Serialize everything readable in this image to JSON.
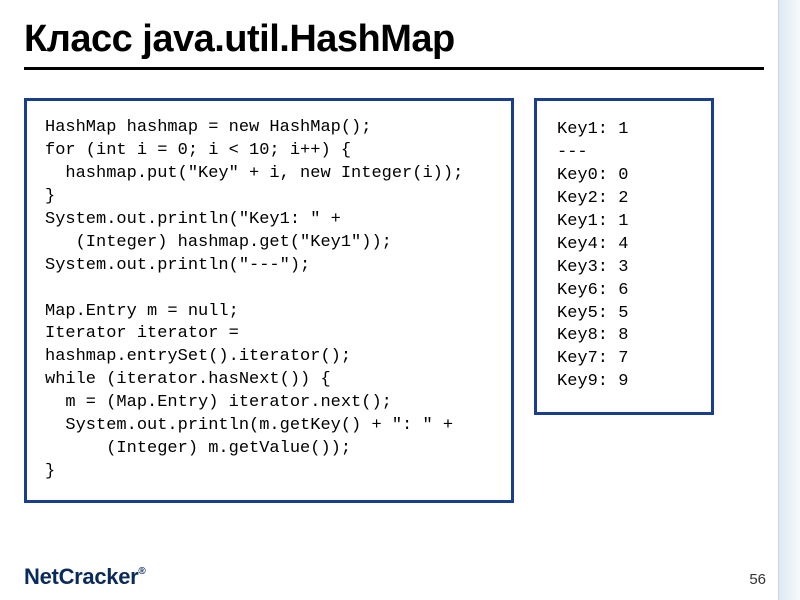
{
  "title": "Класс java.util.HashMap",
  "code_main": "HashMap hashmap = new HashMap();\nfor (int i = 0; i < 10; i++) {\n  hashmap.put(\"Key\" + i, new Integer(i));\n}\nSystem.out.println(\"Key1: \" +\n   (Integer) hashmap.get(\"Key1\"));\nSystem.out.println(\"---\");\n\nMap.Entry m = null;\nIterator iterator =\nhashmap.entrySet().iterator();\nwhile (iterator.hasNext()) {\n  m = (Map.Entry) iterator.next();\n  System.out.println(m.getKey() + \": \" +\n      (Integer) m.getValue());\n}",
  "code_output": "Key1: 1\n---\nKey0: 0\nKey2: 2\nKey1: 1\nKey4: 4\nKey3: 3\nKey6: 6\nKey5: 5\nKey8: 8\nKey7: 7\nKey9: 9",
  "footer": {
    "logo_net": "Net",
    "logo_cracker": "Cracker",
    "logo_reg": "®",
    "page_number": "56"
  }
}
